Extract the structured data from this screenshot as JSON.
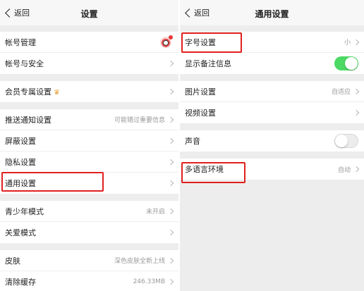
{
  "left": {
    "back_label": "返回",
    "title": "设置",
    "group1": {
      "account_manage": "帐号管理",
      "account_security": "帐号与安全"
    },
    "group2": {
      "vip": "会员专属设置"
    },
    "group3": {
      "push": "推送通知设置",
      "push_value": "可能错过重要信息",
      "block": "屏蔽设置",
      "privacy": "隐私设置",
      "general": "通用设置"
    },
    "group4": {
      "teen": "青少年模式",
      "teen_value": "未开启",
      "care": "关爱模式"
    },
    "group5": {
      "skin": "皮肤",
      "skin_value": "深色皮肤全新上线",
      "cache": "清除缓存",
      "cache_value": "246.33MB"
    }
  },
  "right": {
    "back_label": "返回",
    "title": "通用设置",
    "group1": {
      "font": "字号设置",
      "font_value": "小",
      "remark": "显示备注信息",
      "remark_on": true
    },
    "group2": {
      "image": "图片设置",
      "image_value": "自适应",
      "video": "视频设置"
    },
    "group3": {
      "sound": "声音",
      "sound_on": false
    },
    "group4": {
      "lang": "多语言环境",
      "lang_value": "自动"
    }
  },
  "colors": {
    "highlight": "#e0201d",
    "toggle_on": "#4cd964"
  }
}
